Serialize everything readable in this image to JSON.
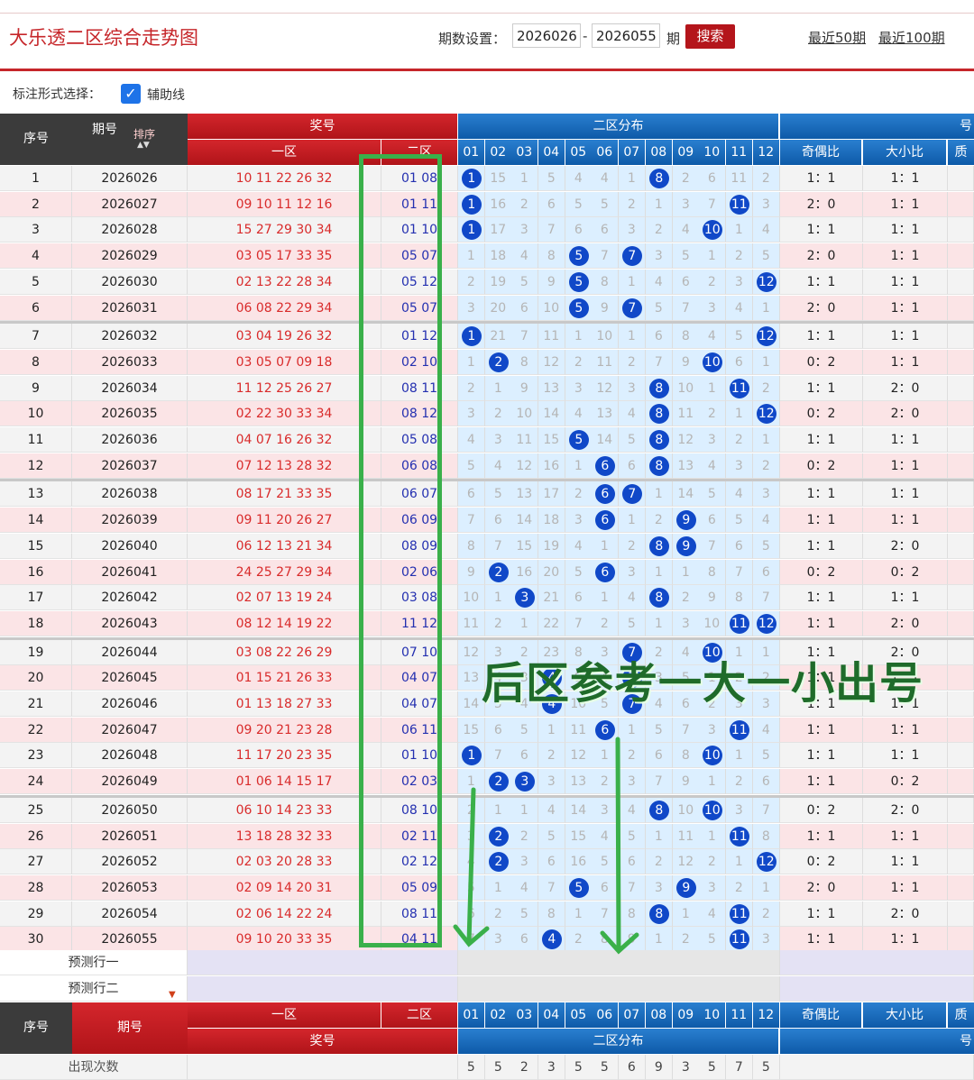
{
  "header": {
    "title": "大乐透二区综合走势图",
    "period_label": "期数设置：",
    "start": "2026026",
    "dash": "-",
    "end": "2026055",
    "unit": "期",
    "search_label": "搜索",
    "link50": "最近50期",
    "link100": "最近100期"
  },
  "mark": {
    "label": "标注形式选择：",
    "checkbox_label": "辅助线",
    "check": "✓"
  },
  "table_head": {
    "seq": "序号",
    "period": "期号",
    "sort": "排序",
    "prize": "奖号",
    "zone1": "一区",
    "zone2": "二区",
    "dist": "二区分布",
    "cols": [
      "01",
      "02",
      "03",
      "04",
      "05",
      "06",
      "07",
      "08",
      "09",
      "10",
      "11",
      "12"
    ],
    "odd_even": "奇偶比",
    "big_small": "大小比",
    "extra": "号",
    "extra2": "质"
  },
  "rows": [
    {
      "seq": "1",
      "period": "2026026",
      "front": "10 11 22 26 32",
      "back": "01 08",
      "dist": [
        "1",
        "15",
        "1",
        "5",
        "4",
        "4",
        "1",
        "8",
        "2",
        "6",
        "11",
        "2"
      ],
      "hits": [
        1,
        8
      ],
      "oe": "1：1",
      "bs": "1：1"
    },
    {
      "seq": "2",
      "period": "2026027",
      "front": "09 10 11 12 16",
      "back": "01 11",
      "dist": [
        "1",
        "16",
        "2",
        "6",
        "5",
        "5",
        "2",
        "1",
        "3",
        "7",
        "11",
        "3"
      ],
      "hits": [
        1,
        11
      ],
      "oe": "2：0",
      "bs": "1：1"
    },
    {
      "seq": "3",
      "period": "2026028",
      "front": "15 27 29 30 34",
      "back": "01 10",
      "dist": [
        "1",
        "17",
        "3",
        "7",
        "6",
        "6",
        "3",
        "2",
        "4",
        "10",
        "1",
        "4"
      ],
      "hits": [
        1,
        10
      ],
      "oe": "1：1",
      "bs": "1：1"
    },
    {
      "seq": "4",
      "period": "2026029",
      "front": "03 05 17 33 35",
      "back": "05 07",
      "dist": [
        "1",
        "18",
        "4",
        "8",
        "5",
        "7",
        "7",
        "3",
        "5",
        "1",
        "2",
        "5"
      ],
      "hits": [
        5,
        7
      ],
      "oe": "2：0",
      "bs": "1：1"
    },
    {
      "seq": "5",
      "period": "2026030",
      "front": "02 13 22 28 34",
      "back": "05 12",
      "dist": [
        "2",
        "19",
        "5",
        "9",
        "5",
        "8",
        "1",
        "4",
        "6",
        "2",
        "3",
        "12"
      ],
      "hits": [
        5,
        12
      ],
      "oe": "1：1",
      "bs": "1：1"
    },
    {
      "seq": "6",
      "period": "2026031",
      "front": "06 08 22 29 34",
      "back": "05 07",
      "dist": [
        "3",
        "20",
        "6",
        "10",
        "5",
        "9",
        "7",
        "5",
        "7",
        "3",
        "4",
        "1"
      ],
      "hits": [
        5,
        7
      ],
      "oe": "2：0",
      "bs": "1：1"
    },
    {
      "seq": "7",
      "period": "2026032",
      "front": "03 04 19 26 32",
      "back": "01 12",
      "dist": [
        "1",
        "21",
        "7",
        "11",
        "1",
        "10",
        "1",
        "6",
        "8",
        "4",
        "5",
        "12"
      ],
      "hits": [
        1,
        12
      ],
      "oe": "1：1",
      "bs": "1：1"
    },
    {
      "seq": "8",
      "period": "2026033",
      "front": "03 05 07 09 18",
      "back": "02 10",
      "dist": [
        "1",
        "2",
        "8",
        "12",
        "2",
        "11",
        "2",
        "7",
        "9",
        "10",
        "6",
        "1"
      ],
      "hits": [
        2,
        10
      ],
      "oe": "0：2",
      "bs": "1：1"
    },
    {
      "seq": "9",
      "period": "2026034",
      "front": "11 12 25 26 27",
      "back": "08 11",
      "dist": [
        "2",
        "1",
        "9",
        "13",
        "3",
        "12",
        "3",
        "8",
        "10",
        "1",
        "11",
        "2"
      ],
      "hits": [
        8,
        11
      ],
      "oe": "1：1",
      "bs": "2：0"
    },
    {
      "seq": "10",
      "period": "2026035",
      "front": "02 22 30 33 34",
      "back": "08 12",
      "dist": [
        "3",
        "2",
        "10",
        "14",
        "4",
        "13",
        "4",
        "8",
        "11",
        "2",
        "1",
        "12"
      ],
      "hits": [
        8,
        12
      ],
      "oe": "0：2",
      "bs": "2：0"
    },
    {
      "seq": "11",
      "period": "2026036",
      "front": "04 07 16 26 32",
      "back": "05 08",
      "dist": [
        "4",
        "3",
        "11",
        "15",
        "5",
        "14",
        "5",
        "8",
        "12",
        "3",
        "2",
        "1"
      ],
      "hits": [
        5,
        8
      ],
      "oe": "1：1",
      "bs": "1：1"
    },
    {
      "seq": "12",
      "period": "2026037",
      "front": "07 12 13 28 32",
      "back": "06 08",
      "dist": [
        "5",
        "4",
        "12",
        "16",
        "1",
        "6",
        "6",
        "8",
        "13",
        "4",
        "3",
        "2"
      ],
      "hits": [
        6,
        8
      ],
      "oe": "0：2",
      "bs": "1：1"
    },
    {
      "seq": "13",
      "period": "2026038",
      "front": "08 17 21 33 35",
      "back": "06 07",
      "dist": [
        "6",
        "5",
        "13",
        "17",
        "2",
        "6",
        "7",
        "1",
        "14",
        "5",
        "4",
        "3"
      ],
      "hits": [
        6,
        7
      ],
      "oe": "1：1",
      "bs": "1：1"
    },
    {
      "seq": "14",
      "period": "2026039",
      "front": "09 11 20 26 27",
      "back": "06 09",
      "dist": [
        "7",
        "6",
        "14",
        "18",
        "3",
        "6",
        "1",
        "2",
        "9",
        "6",
        "5",
        "4"
      ],
      "hits": [
        6,
        9
      ],
      "oe": "1：1",
      "bs": "1：1"
    },
    {
      "seq": "15",
      "period": "2026040",
      "front": "06 12 13 21 34",
      "back": "08 09",
      "dist": [
        "8",
        "7",
        "15",
        "19",
        "4",
        "1",
        "2",
        "8",
        "9",
        "7",
        "6",
        "5"
      ],
      "hits": [
        8,
        9
      ],
      "oe": "1：1",
      "bs": "2：0"
    },
    {
      "seq": "16",
      "period": "2026041",
      "front": "24 25 27 29 34",
      "back": "02 06",
      "dist": [
        "9",
        "2",
        "16",
        "20",
        "5",
        "6",
        "3",
        "1",
        "1",
        "8",
        "7",
        "6"
      ],
      "hits": [
        2,
        6
      ],
      "oe": "0：2",
      "bs": "0：2"
    },
    {
      "seq": "17",
      "period": "2026042",
      "front": "02 07 13 19 24",
      "back": "03 08",
      "dist": [
        "10",
        "1",
        "3",
        "21",
        "6",
        "1",
        "4",
        "8",
        "2",
        "9",
        "8",
        "7"
      ],
      "hits": [
        3,
        8
      ],
      "oe": "1：1",
      "bs": "1：1"
    },
    {
      "seq": "18",
      "period": "2026043",
      "front": "08 12 14 19 22",
      "back": "11 12",
      "dist": [
        "11",
        "2",
        "1",
        "22",
        "7",
        "2",
        "5",
        "1",
        "3",
        "10",
        "11",
        "12"
      ],
      "hits": [
        11,
        12
      ],
      "oe": "1：1",
      "bs": "2：0"
    },
    {
      "seq": "19",
      "period": "2026044",
      "front": "03 08 22 26 29",
      "back": "07 10",
      "dist": [
        "12",
        "3",
        "2",
        "23",
        "8",
        "3",
        "7",
        "2",
        "4",
        "10",
        "1",
        "1"
      ],
      "hits": [
        7,
        10
      ],
      "oe": "1：1",
      "bs": "2：0"
    },
    {
      "seq": "20",
      "period": "2026045",
      "front": "01 15 21 26 33",
      "back": "04 07",
      "dist": [
        "13",
        "4",
        "3",
        "4",
        "9",
        "4",
        "7",
        "3",
        "5",
        "1",
        "2",
        "2"
      ],
      "hits": [
        4,
        7
      ],
      "oe": "1：1",
      "bs": "1：1"
    },
    {
      "seq": "21",
      "period": "2026046",
      "front": "01 13 18 27 33",
      "back": "04 07",
      "dist": [
        "14",
        "5",
        "4",
        "4",
        "10",
        "5",
        "7",
        "4",
        "6",
        "2",
        "3",
        "3"
      ],
      "hits": [
        4,
        7
      ],
      "oe": "1：1",
      "bs": "1：1"
    },
    {
      "seq": "22",
      "period": "2026047",
      "front": "09 20 21 23 28",
      "back": "06 11",
      "dist": [
        "15",
        "6",
        "5",
        "1",
        "11",
        "6",
        "1",
        "5",
        "7",
        "3",
        "11",
        "4"
      ],
      "hits": [
        6,
        11
      ],
      "oe": "1：1",
      "bs": "1：1"
    },
    {
      "seq": "23",
      "period": "2026048",
      "front": "11 17 20 23 35",
      "back": "01 10",
      "dist": [
        "1",
        "7",
        "6",
        "2",
        "12",
        "1",
        "2",
        "6",
        "8",
        "10",
        "1",
        "5"
      ],
      "hits": [
        1,
        10
      ],
      "oe": "1：1",
      "bs": "1：1"
    },
    {
      "seq": "24",
      "period": "2026049",
      "front": "01 06 14 15 17",
      "back": "02 03",
      "dist": [
        "1",
        "2",
        "3",
        "3",
        "13",
        "2",
        "3",
        "7",
        "9",
        "1",
        "2",
        "6"
      ],
      "hits": [
        2,
        3
      ],
      "oe": "1：1",
      "bs": "0：2"
    },
    {
      "seq": "25",
      "period": "2026050",
      "front": "06 10 14 23 33",
      "back": "08 10",
      "dist": [
        "2",
        "1",
        "1",
        "4",
        "14",
        "3",
        "4",
        "8",
        "10",
        "10",
        "3",
        "7"
      ],
      "hits": [
        8,
        10
      ],
      "oe": "0：2",
      "bs": "2：0"
    },
    {
      "seq": "26",
      "period": "2026051",
      "front": "13 18 28 32 33",
      "back": "02 11",
      "dist": [
        "3",
        "2",
        "2",
        "5",
        "15",
        "4",
        "5",
        "1",
        "11",
        "1",
        "11",
        "8"
      ],
      "hits": [
        2,
        11
      ],
      "oe": "1：1",
      "bs": "1：1"
    },
    {
      "seq": "27",
      "period": "2026052",
      "front": "02 03 20 28 33",
      "back": "02 12",
      "dist": [
        "4",
        "2",
        "3",
        "6",
        "16",
        "5",
        "6",
        "2",
        "12",
        "2",
        "1",
        "12"
      ],
      "hits": [
        2,
        12
      ],
      "oe": "0：2",
      "bs": "1：1"
    },
    {
      "seq": "28",
      "period": "2026053",
      "front": "02 09 14 20 31",
      "back": "05 09",
      "dist": [
        "5",
        "1",
        "4",
        "7",
        "5",
        "6",
        "7",
        "3",
        "9",
        "3",
        "2",
        "1"
      ],
      "hits": [
        5,
        9
      ],
      "oe": "2：0",
      "bs": "1：1"
    },
    {
      "seq": "29",
      "period": "2026054",
      "front": "02 06 14 22 24",
      "back": "08 11",
      "dist": [
        "6",
        "2",
        "5",
        "8",
        "1",
        "7",
        "8",
        "8",
        "1",
        "4",
        "11",
        "2"
      ],
      "hits": [
        8,
        11
      ],
      "oe": "1：1",
      "bs": "2：0"
    },
    {
      "seq": "30",
      "period": "2026055",
      "front": "09 10 20 33 35",
      "back": "04 11",
      "dist": [
        "7",
        "3",
        "6",
        "4",
        "2",
        "8",
        "9",
        "1",
        "2",
        "5",
        "11",
        "3"
      ],
      "hits": [
        4,
        11
      ],
      "oe": "1：1",
      "bs": "1：1"
    }
  ],
  "predict": {
    "row1": "预测行一",
    "row2": "预测行二"
  },
  "footer": {
    "count_label": "出现次数",
    "counts": [
      "5",
      "5",
      "2",
      "3",
      "5",
      "5",
      "6",
      "9",
      "3",
      "5",
      "7",
      "5"
    ]
  },
  "overlay": {
    "text": "后区参考一大一小出号"
  }
}
